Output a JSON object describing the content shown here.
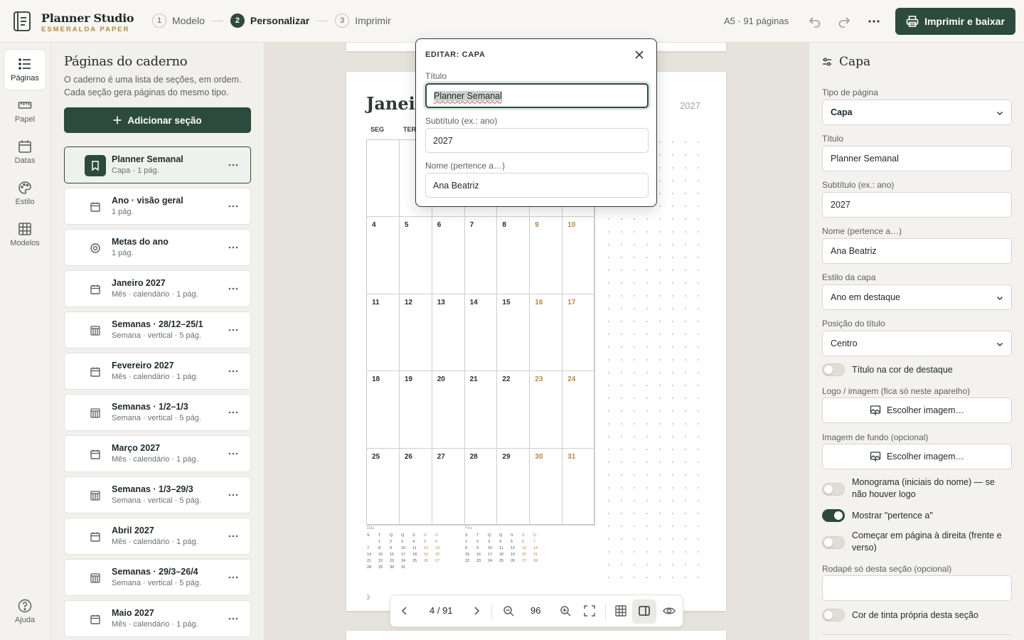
{
  "header": {
    "brand_name": "Planner Studio",
    "brand_sub": "ESMERALDA PAPER",
    "steps": [
      {
        "num": "1",
        "label": "Modelo"
      },
      {
        "num": "2",
        "label": "Personalizar"
      },
      {
        "num": "3",
        "label": "Imprimir"
      }
    ],
    "pages_info": "A5 · 91 páginas",
    "print_label": "Imprimir e baixar"
  },
  "rail": {
    "items": [
      {
        "label": "Páginas",
        "icon": "list-icon"
      },
      {
        "label": "Papel",
        "icon": "ruler-icon"
      },
      {
        "label": "Datas",
        "icon": "calendar-icon"
      },
      {
        "label": "Estilo",
        "icon": "palette-icon"
      },
      {
        "label": "Modelos",
        "icon": "grid-icon"
      }
    ],
    "help_label": "Ajuda"
  },
  "sidebar": {
    "title": "Páginas do caderno",
    "description": "O caderno é uma lista de seções, em ordem. Cada seção gera páginas do mesmo tipo.",
    "add_label": "Adicionar seção",
    "sections": [
      {
        "title": "Planner Semanal",
        "sub": "Capa · 1 pág.",
        "icon": "bookmark-icon"
      },
      {
        "title": "Ano · visão geral",
        "sub": "1 pág.",
        "icon": "calendar-icon"
      },
      {
        "title": "Metas do ano",
        "sub": "1 pág.",
        "icon": "target-icon"
      },
      {
        "title": "Janeiro 2027",
        "sub": "Mês · calendário · 1 pág.",
        "icon": "calendar-icon"
      },
      {
        "title": "Semanas · 28/12–25/1",
        "sub": "Semana · vertical · 5 pág.",
        "icon": "week-icon"
      },
      {
        "title": "Fevereiro 2027",
        "sub": "Mês · calendário · 1 pág.",
        "icon": "calendar-icon"
      },
      {
        "title": "Semanas · 1/2–1/3",
        "sub": "Semana · vertical · 5 pág.",
        "icon": "week-icon"
      },
      {
        "title": "Março 2027",
        "sub": "Mês · calendário · 1 pág.",
        "icon": "calendar-icon"
      },
      {
        "title": "Semanas · 1/3–29/3",
        "sub": "Semana · vertical · 5 pág.",
        "icon": "week-icon"
      },
      {
        "title": "Abril 2027",
        "sub": "Mês · calendário · 1 pág.",
        "icon": "calendar-icon"
      },
      {
        "title": "Semanas · 29/3–26/4",
        "sub": "Semana · vertical · 5 pág.",
        "icon": "week-icon"
      },
      {
        "title": "Maio 2027",
        "sub": "Mês · calendário · 1 pág.",
        "icon": "calendar-icon"
      }
    ]
  },
  "preview": {
    "month_title": "Janeiro",
    "year": "2027",
    "weekday_heads": [
      "SEG",
      "TER"
    ],
    "weeks": [
      [
        "",
        "",
        "",
        "",
        "",
        "",
        ""
      ],
      [
        "4",
        "5",
        "6",
        "7",
        "8",
        "9",
        "10"
      ],
      [
        "11",
        "12",
        "13",
        "14",
        "15",
        "16",
        "17"
      ],
      [
        "18",
        "19",
        "20",
        "21",
        "22",
        "23",
        "24"
      ],
      [
        "25",
        "26",
        "27",
        "28",
        "29",
        "30",
        "31"
      ]
    ],
    "mini_dec": {
      "label": "Dez",
      "heads": [
        "S",
        "T",
        "Q",
        "Q",
        "S",
        "S",
        "D"
      ],
      "rows": [
        [
          "",
          "1",
          "2",
          "3",
          "4",
          "5",
          "6"
        ],
        [
          "7",
          "8",
          "9",
          "10",
          "11",
          "12",
          "13"
        ],
        [
          "14",
          "15",
          "16",
          "17",
          "18",
          "19",
          "20"
        ],
        [
          "21",
          "22",
          "23",
          "24",
          "25",
          "26",
          "27"
        ],
        [
          "28",
          "29",
          "30",
          "31",
          "",
          "",
          ""
        ]
      ]
    },
    "mini_feb": {
      "label": "Fev",
      "heads": [
        "S",
        "T",
        "Q",
        "Q",
        "S",
        "S",
        "D"
      ],
      "rows": [
        [
          "1",
          "2",
          "3",
          "4",
          "5",
          "6",
          "7"
        ],
        [
          "8",
          "9",
          "10",
          "11",
          "12",
          "13",
          "14"
        ],
        [
          "15",
          "16",
          "17",
          "18",
          "19",
          "20",
          "21"
        ],
        [
          "22",
          "23",
          "24",
          "25",
          "26",
          "27",
          "28"
        ]
      ]
    },
    "page_number": "3"
  },
  "toolbar": {
    "page_counter": "4 / 91",
    "zoom": "96"
  },
  "popover": {
    "title": "EDITAR: CAPA",
    "title_label": "Título",
    "title_value": "Planner Semanal",
    "subtitle_label": "Subtítulo (ex.: ano)",
    "subtitle_value": "2027",
    "name_label": "Nome (pertence a…)",
    "name_value": "Ana Beatriz"
  },
  "right_panel": {
    "heading": "Capa",
    "page_type_label": "Tipo de página",
    "page_type_value": "Capa",
    "title_label": "Título",
    "title_value": "Planner Semanal",
    "subtitle_label": "Subtítulo (ex.: ano)",
    "subtitle_value": "2027",
    "name_label": "Nome (pertence a…)",
    "name_value": "Ana Beatriz",
    "cover_style_label": "Estilo da capa",
    "cover_style_value": "Ano em destaque",
    "title_pos_label": "Posição do título",
    "title_pos_value": "Centro",
    "toggle_accent": "Título na cor de destaque",
    "logo_label": "Logo / imagem (fica só neste aparelho)",
    "choose_image": "Escolher imagem…",
    "bg_label": "Imagem de fundo (opcional)",
    "choose_image_bg": "Escolher imagem…",
    "toggle_monogram": "Monograma (iniciais do nome) — se não houver logo",
    "toggle_belongs": "Mostrar \"pertence a\"",
    "toggle_right_page": "Começar em página à direita (frente e verso)",
    "footer_label": "Rodapé só desta seção (opcional)",
    "footer_value": "",
    "toggle_ink": "Cor de tinta própria desta seção"
  },
  "colors": {
    "accent": "#2d4a3e",
    "gold": "#b8893c"
  }
}
